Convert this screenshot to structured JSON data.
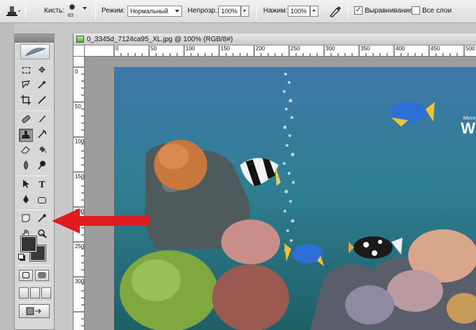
{
  "options_bar": {
    "brush_label": "Кисть:",
    "brush_size": "63",
    "mode_label": "Режим:",
    "mode_value": "Нормальный",
    "opacity_label": "Непрозр.:",
    "opacity_value": "100%",
    "pressure_label": "Нажим:",
    "pressure_value": "100%",
    "aligned_label": "Выравнивание",
    "aligned_checked": true,
    "all_layers_label": "Все слои",
    "all_layers_checked": false,
    "icons": [
      "clone-stamp-icon",
      "brush-preset-icon",
      "airbrush-icon"
    ]
  },
  "toolbox": {
    "tools": [
      "marquee",
      "move",
      "lasso",
      "magic-wand",
      "crop",
      "eyedropper-slice",
      "healing-brush",
      "brush",
      "clone-stamp",
      "history-brush",
      "eraser",
      "paint-bucket",
      "blur",
      "dodge",
      "path-selection",
      "type",
      "pen",
      "shape",
      "notes",
      "eyedropper",
      "hand",
      "zoom"
    ],
    "selected_tool": "clone-stamp",
    "foreground_color": "#333333",
    "background_color": "#3a3a3a"
  },
  "document": {
    "title": "0_3345d_7124ca95_XL.jpg @ 100% (RGB/8#)",
    "ruler_top_ticks": [
      "0",
      "50",
      "100",
      "150",
      "200",
      "250",
      "300",
      "350",
      "400",
      "450",
      "500"
    ],
    "ruler_left_ticks": [
      "0",
      "50",
      "100",
      "150",
      "200",
      "250",
      "300"
    ],
    "canvas_logo": "W",
    "canvas_logo_small": "Micro"
  },
  "annotation": {
    "arrow_color": "#e01b1b"
  }
}
